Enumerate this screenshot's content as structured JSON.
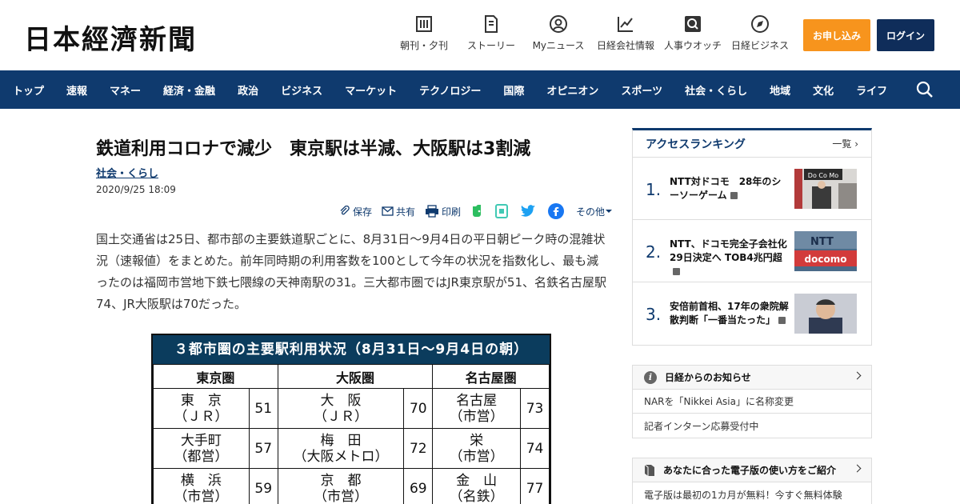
{
  "header": {
    "logo": "日本經濟新聞",
    "nav": [
      {
        "label": "朝刊・夕刊",
        "icon": "newspaper-icon"
      },
      {
        "label": "ストーリー",
        "icon": "document-icon"
      },
      {
        "label": "Myニュース",
        "icon": "person-icon"
      },
      {
        "label": "日経会社情報",
        "icon": "chart-icon"
      },
      {
        "label": "人事ウオッチ",
        "icon": "search-icon"
      },
      {
        "label": "日経ビジネス",
        "icon": "compass-icon"
      }
    ],
    "apply_label": "お申し込み",
    "login_label": "ログイン",
    "colors": {
      "apply": "#f7941d",
      "login": "#0f2d5a",
      "nav": "#0f3a6e"
    }
  },
  "nav": [
    "トップ",
    "速報",
    "マネー",
    "経済・金融",
    "政治",
    "ビジネス",
    "マーケット",
    "テクノロジー",
    "国際",
    "オピニオン",
    "スポーツ",
    "社会・くらし",
    "地域",
    "文化",
    "ライフ"
  ],
  "article": {
    "title": "鉄道利用コロナで減少　東京駅は半減、大阪駅は3割減",
    "category": "社会・くらし",
    "date": "2020/9/25 18:09",
    "share": {
      "save": "保存",
      "share": "共有",
      "print": "印刷",
      "other": "その他"
    },
    "body": "国土交通省は25日、都市部の主要鉄道駅ごとに、8月31日～9月4日の平日朝ピーク時の混雑状況（速報値）をまとめた。前年同時期の利用客数を100として今年の状況を指数化し、最も減ったのは福岡市営地下鉄七隈線の天神南駅の31。三大都市圏ではJR東京駅が51、名鉄名古屋駅74、JR大阪駅は70だった。"
  },
  "table": {
    "title": "３都市圏の主要駅利用状況（8月31日～9月4日の朝）",
    "headers": [
      "東京圏",
      "大阪圏",
      "名古屋圏"
    ],
    "rows": [
      [
        {
          "name1": "東　京",
          "name2": "（ＪＲ）",
          "v": "51"
        },
        {
          "name1": "大　阪",
          "name2": "（ＪＲ）",
          "v": "70"
        },
        {
          "name1": "名古屋",
          "name2": "（市営）",
          "v": "73"
        }
      ],
      [
        {
          "name1": "大手町",
          "name2": "（都営）",
          "v": "57"
        },
        {
          "name1": "梅　田",
          "name2": "（大阪メトロ）",
          "v": "72"
        },
        {
          "name1": "栄",
          "name2": "（市営）",
          "v": "74"
        }
      ],
      [
        {
          "name1": "横　浜",
          "name2": "（市営）",
          "v": "59"
        },
        {
          "name1": "京　都",
          "name2": "（市営）",
          "v": "69"
        },
        {
          "name1": "金　山",
          "name2": "（名鉄）",
          "v": "77"
        }
      ]
    ]
  },
  "ranking": {
    "title": "アクセスランキング",
    "more": "一覧",
    "items": [
      {
        "num": "1.",
        "text": "NTT対ドコモ　28年のシーソーゲーム"
      },
      {
        "num": "2.",
        "text": "NTT、ドコモ完全子会社化 29日決定へ TOB4兆円超"
      },
      {
        "num": "3.",
        "text": "安倍前首相、17年の衆院解散判断「一番当たった」"
      }
    ]
  },
  "notice": {
    "title": "日経からのお知らせ",
    "items": [
      "NARを「Nikkei Asia」に名称変更",
      "記者インターン応募受付中"
    ]
  },
  "guide": {
    "title": "あなたに合った電子版の使い方をご紹介",
    "item": "電子版は最初の1カ月が無料！今すぐ無料体験"
  }
}
